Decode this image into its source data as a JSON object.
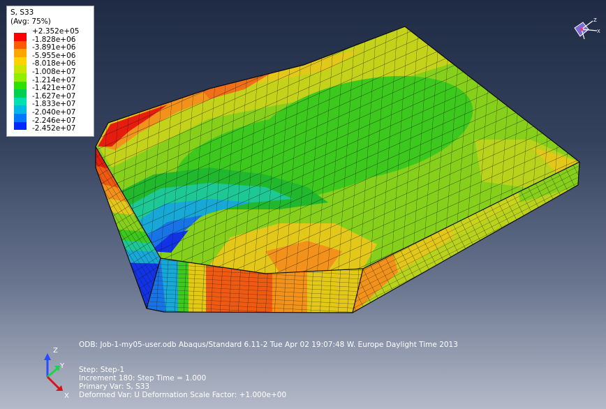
{
  "legend": {
    "title": "S, S33",
    "subtitle": "(Avg: 75%)",
    "values": [
      "+2.352e+05",
      "-1.828e+06",
      "-3.891e+06",
      "-5.955e+06",
      "-8.018e+06",
      "-1.008e+07",
      "-1.214e+07",
      "-1.421e+07",
      "-1.627e+07",
      "-1.833e+07",
      "-2.040e+07",
      "-2.246e+07",
      "-2.452e+07"
    ],
    "colors": [
      "#ff0000",
      "#ff5a00",
      "#ffa500",
      "#ffd200",
      "#c8e600",
      "#8ef000",
      "#2ee000",
      "#00d050",
      "#00e0b0",
      "#00b8e6",
      "#0078ff",
      "#0028ff"
    ]
  },
  "info": {
    "odb_line": "ODB: Job-1-my05-user.odb    Abaqus/Standard 6.11-2    Tue Apr 02 19:07:48 W. Europe Daylight Time 2013",
    "step_line": "Step: Step-1",
    "increment_line": "Increment    180: Step Time =     1.000",
    "primary_var_line": "Primary Var: S, S33",
    "deformed_var_line": "Deformed Var: U   Deformation Scale Factor: +1.000e+00"
  },
  "triad": {
    "z": "Z",
    "y": "Y",
    "x": "X"
  },
  "mesh_colors": {
    "red": "#e61c0e",
    "orange_red": "#ef5a12",
    "orange": "#f2921a",
    "yellow": "#e3c81a",
    "yellow_green": "#b9d21c",
    "lime": "#86d01c",
    "green": "#3cc81c",
    "green_dark": "#22b82e",
    "teal": "#1ec894",
    "cyan": "#18a8d6",
    "blue_light": "#1874e6",
    "blue": "#1232e6",
    "mesh_line": "#1a1a1a"
  }
}
